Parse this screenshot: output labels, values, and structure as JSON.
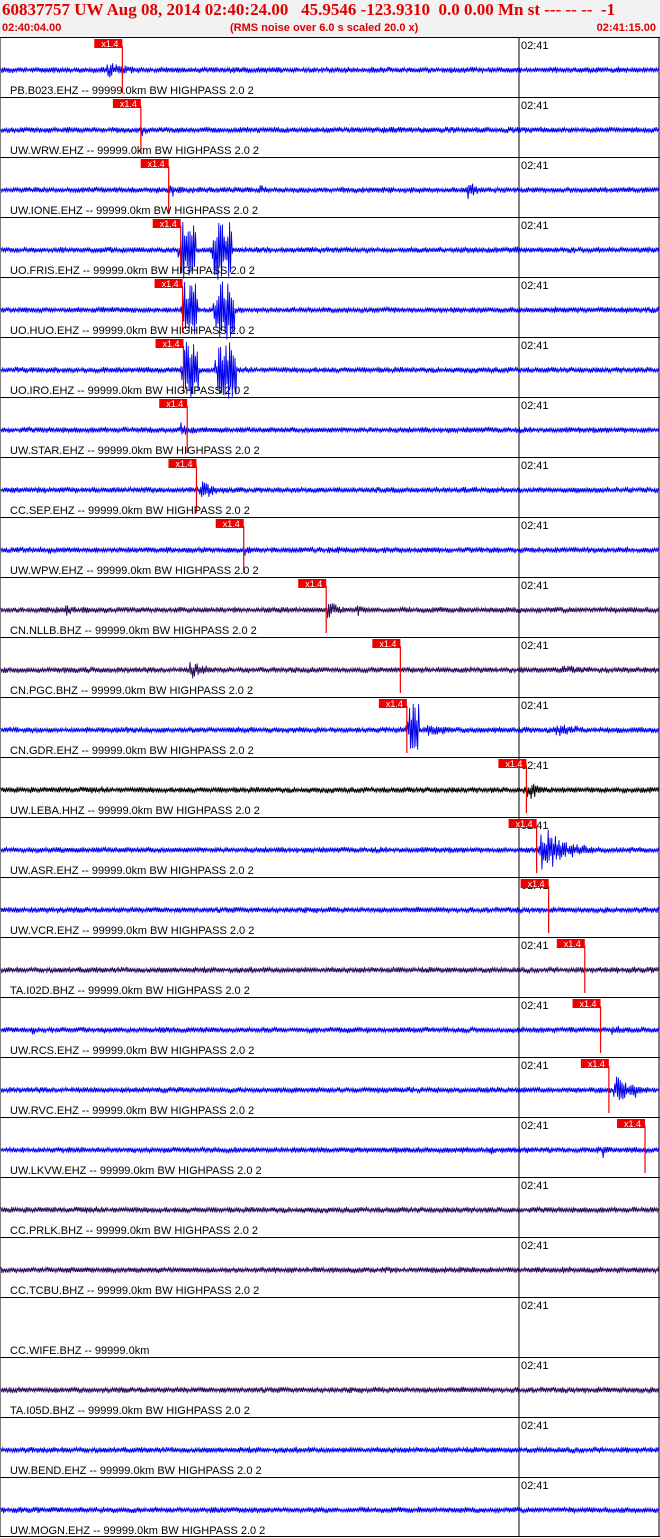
{
  "header": {
    "title": "60837757 UW Aug 08, 2014 02:40:24.00   45.9546 -123.9310  0.0 0.00 Mn st --- -- --  -1",
    "start_time": "02:40:04.00",
    "note": "(RMS noise over 6.0 s scaled 20.0 x)",
    "end_time": "02:41:15.00"
  },
  "colors": {
    "title_red": "#e00000",
    "trace_blue": "#0000ee",
    "trace_purple": "#2a0a5a",
    "trace_black": "#000000",
    "pick_red": "#ee0000",
    "header_bg": "#f2f2f2"
  },
  "chart_data": {
    "type": "line",
    "title": "60837757 UW Aug 08, 2014 02:40:24.00   45.9546 -123.9310  0.0 0.00 Mn st --- -- --  -1",
    "x_start": "02:40:04.00",
    "x_end": "02:41:15.00",
    "x_range_seconds": [
      0,
      71
    ],
    "time_marks": [
      {
        "label": "02:41",
        "t": 56
      }
    ],
    "pick_label": "x1.4",
    "series": [
      {
        "name": "PB.B023.EHZ -- 99999.0km BW  HIGHPASS  2.0  2",
        "pick_t": 13.2,
        "color": "blue",
        "bursts": [
          {
            "t": 11.5,
            "amp": 10,
            "dur": 7
          }
        ]
      },
      {
        "name": "UW.WRW.EHZ -- 99999.0km BW  HIGHPASS  2.0  2",
        "pick_t": 15.2,
        "color": "blue",
        "bursts": [
          {
            "t": 15.3,
            "amp": 7,
            "dur": 3
          }
        ]
      },
      {
        "name": "UW.IONE.EHZ -- 99999.0km BW  HIGHPASS  2.0  2",
        "pick_t": 18.2,
        "color": "blue",
        "bursts": [
          {
            "t": 18.3,
            "amp": 9,
            "dur": 3
          },
          {
            "t": 28,
            "amp": 6,
            "dur": 6
          },
          {
            "t": 50.5,
            "amp": 11,
            "dur": 3
          }
        ]
      },
      {
        "name": "UO.FRIS.EHZ -- 99999.0km BW  HIGHPASS  2.0  2",
        "pick_t": 19.5,
        "color": "blue",
        "bursts": [
          {
            "t": 19.5,
            "amp": 30,
            "dur": 1.8,
            "sat": true
          },
          {
            "t": 23,
            "amp": 30,
            "dur": 2.2,
            "sat": true
          },
          {
            "t": 55.5,
            "amp": 8,
            "dur": 0.8
          }
        ]
      },
      {
        "name": "UO.HUO.EHZ -- 99999.0km BW  HIGHPASS  2.0  2",
        "pick_t": 19.7,
        "color": "blue",
        "bursts": [
          {
            "t": 19.7,
            "amp": 30,
            "dur": 1.8,
            "sat": true
          },
          {
            "t": 23.3,
            "amp": 30,
            "dur": 2.2,
            "sat": true
          }
        ]
      },
      {
        "name": "UO.IRO.EHZ -- 99999.0km BW  HIGHPASS  2.0  2",
        "pick_t": 19.8,
        "color": "blue",
        "bursts": [
          {
            "t": 19.8,
            "amp": 30,
            "dur": 1.8,
            "sat": true
          },
          {
            "t": 23.5,
            "amp": 30,
            "dur": 2.2,
            "sat": true
          }
        ]
      },
      {
        "name": "UW.STAR.EHZ -- 99999.0km BW  HIGHPASS  2.0  2",
        "pick_t": 20.2,
        "color": "blue",
        "bursts": [
          {
            "t": 19.5,
            "amp": 12,
            "dur": 3
          }
        ]
      },
      {
        "name": "CC.SEP.EHZ -- 99999.0km BW  HIGHPASS  2.0  2",
        "pick_t": 21.2,
        "color": "blue",
        "bursts": [
          {
            "t": 21.5,
            "amp": 14,
            "dur": 4
          }
        ]
      },
      {
        "name": "UW.WPW.EHZ -- 99999.0km BW  HIGHPASS  2.0  2",
        "pick_t": 26.3,
        "color": "blue",
        "bursts": [
          {
            "t": 5,
            "amp": 6,
            "dur": 2
          },
          {
            "t": 26.4,
            "amp": 7,
            "dur": 3
          },
          {
            "t": 67.5,
            "amp": 6,
            "dur": 2
          }
        ]
      },
      {
        "name": "CN.NLLB.BHZ -- 99999.0km BW  HIGHPASS  2.0  2",
        "pick_t": 35.2,
        "color": "purple",
        "bursts": [
          {
            "t": 7,
            "amp": 10,
            "dur": 2
          },
          {
            "t": 35.3,
            "amp": 14,
            "dur": 3
          },
          {
            "t": 38.5,
            "amp": 9,
            "dur": 2
          }
        ]
      },
      {
        "name": "CN.PGC.BHZ -- 99999.0km BW  HIGHPASS  2.0  2",
        "pick_t": 43.2,
        "color": "purple",
        "bursts": [
          {
            "t": 20.5,
            "amp": 11,
            "dur": 5
          },
          {
            "t": 60,
            "amp": 7,
            "dur": 8
          }
        ]
      },
      {
        "name": "CN.GDR.EHZ -- 99999.0km BW  HIGHPASS  2.0  2",
        "pick_t": 43.9,
        "color": "blue",
        "bursts": [
          {
            "t": 44.1,
            "amp": 30,
            "dur": 1.2,
            "sat": true
          },
          {
            "t": 46,
            "amp": 10,
            "dur": 5
          },
          {
            "t": 60,
            "amp": 9,
            "dur": 8
          }
        ]
      },
      {
        "name": "UW.LEBA.HHZ -- 99999.0km BW  HIGHPASS  2.0  2",
        "pick_t": 56.8,
        "color": "black",
        "bursts": [
          {
            "t": 56.8,
            "amp": 14,
            "dur": 3
          }
        ]
      },
      {
        "name": "UW.ASR.EHZ -- 99999.0km BW  HIGHPASS  2.0  2",
        "pick_t": 57.9,
        "color": "blue",
        "bursts": [
          {
            "t": 58.3,
            "amp": 30,
            "dur": 6
          }
        ]
      },
      {
        "name": "UW.VCR.EHZ -- 99999.0km BW  HIGHPASS  2.0  2",
        "pick_t": 59.2,
        "color": "blue",
        "bursts": [
          {
            "t": 5,
            "amp": 7,
            "dur": 1
          }
        ]
      },
      {
        "name": "TA.I02D.BHZ -- 99999.0km BW  HIGHPASS  2.0  2",
        "pick_t": 63.1,
        "color": "purple",
        "bursts": []
      },
      {
        "name": "UW.RCS.EHZ -- 99999.0km BW  HIGHPASS  2.0  2",
        "pick_t": 64.8,
        "color": "blue",
        "bursts": [
          {
            "t": 3.5,
            "amp": 8,
            "dur": 1
          },
          {
            "t": 66,
            "amp": 9,
            "dur": 3
          }
        ]
      },
      {
        "name": "UW.RVC.EHZ -- 99999.0km BW  HIGHPASS  2.0  2",
        "pick_t": 65.7,
        "color": "blue",
        "bursts": [
          {
            "t": 66.5,
            "amp": 22,
            "dur": 4
          }
        ]
      },
      {
        "name": "UW.LKVW.EHZ -- 99999.0km BW  HIGHPASS  2.0  2",
        "pick_t": 69.6,
        "color": "blue",
        "bursts": [
          {
            "t": 53,
            "amp": 7,
            "dur": 1
          },
          {
            "t": 65,
            "amp": 10,
            "dur": 1
          }
        ]
      },
      {
        "name": "CC.PRLK.BHZ -- 99999.0km BW  HIGHPASS  2.0  2",
        "color": "purple",
        "bursts": []
      },
      {
        "name": "CC.TCBU.BHZ -- 99999.0km BW  HIGHPASS  2.0  2",
        "color": "purple",
        "bursts": []
      },
      {
        "name": "CC.WIFE.BHZ -- 99999.0km",
        "color": "none",
        "bursts": []
      },
      {
        "name": "TA.I05D.BHZ -- 99999.0km BW  HIGHPASS  2.0  2",
        "color": "purple",
        "bursts": []
      },
      {
        "name": "UW.BEND.EHZ -- 99999.0km BW  HIGHPASS  2.0  2",
        "color": "blue",
        "bursts": []
      },
      {
        "name": "UW.MOGN.EHZ -- 99999.0km BW  HIGHPASS  2.0  2",
        "color": "blue",
        "bursts": []
      }
    ]
  }
}
